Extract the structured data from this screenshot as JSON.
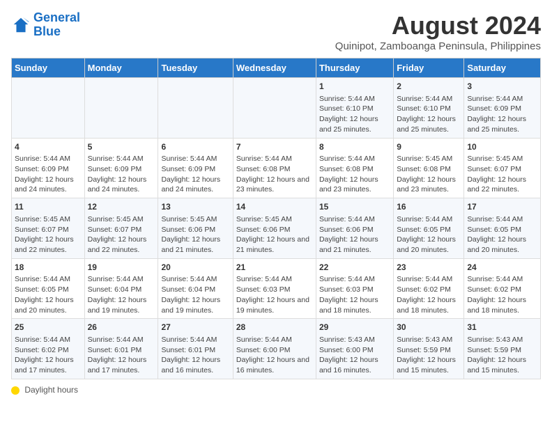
{
  "header": {
    "logo_general": "General",
    "logo_blue": "Blue",
    "main_title": "August 2024",
    "subtitle": "Quinipot, Zamboanga Peninsula, Philippines"
  },
  "columns": [
    "Sunday",
    "Monday",
    "Tuesday",
    "Wednesday",
    "Thursday",
    "Friday",
    "Saturday"
  ],
  "weeks": [
    [
      {
        "day": "",
        "info": ""
      },
      {
        "day": "",
        "info": ""
      },
      {
        "day": "",
        "info": ""
      },
      {
        "day": "",
        "info": ""
      },
      {
        "day": "1",
        "info": "Sunrise: 5:44 AM\nSunset: 6:10 PM\nDaylight: 12 hours and 25 minutes."
      },
      {
        "day": "2",
        "info": "Sunrise: 5:44 AM\nSunset: 6:10 PM\nDaylight: 12 hours and 25 minutes."
      },
      {
        "day": "3",
        "info": "Sunrise: 5:44 AM\nSunset: 6:09 PM\nDaylight: 12 hours and 25 minutes."
      }
    ],
    [
      {
        "day": "4",
        "info": "Sunrise: 5:44 AM\nSunset: 6:09 PM\nDaylight: 12 hours and 24 minutes."
      },
      {
        "day": "5",
        "info": "Sunrise: 5:44 AM\nSunset: 6:09 PM\nDaylight: 12 hours and 24 minutes."
      },
      {
        "day": "6",
        "info": "Sunrise: 5:44 AM\nSunset: 6:09 PM\nDaylight: 12 hours and 24 minutes."
      },
      {
        "day": "7",
        "info": "Sunrise: 5:44 AM\nSunset: 6:08 PM\nDaylight: 12 hours and 23 minutes."
      },
      {
        "day": "8",
        "info": "Sunrise: 5:44 AM\nSunset: 6:08 PM\nDaylight: 12 hours and 23 minutes."
      },
      {
        "day": "9",
        "info": "Sunrise: 5:45 AM\nSunset: 6:08 PM\nDaylight: 12 hours and 23 minutes."
      },
      {
        "day": "10",
        "info": "Sunrise: 5:45 AM\nSunset: 6:07 PM\nDaylight: 12 hours and 22 minutes."
      }
    ],
    [
      {
        "day": "11",
        "info": "Sunrise: 5:45 AM\nSunset: 6:07 PM\nDaylight: 12 hours and 22 minutes."
      },
      {
        "day": "12",
        "info": "Sunrise: 5:45 AM\nSunset: 6:07 PM\nDaylight: 12 hours and 22 minutes."
      },
      {
        "day": "13",
        "info": "Sunrise: 5:45 AM\nSunset: 6:06 PM\nDaylight: 12 hours and 21 minutes."
      },
      {
        "day": "14",
        "info": "Sunrise: 5:45 AM\nSunset: 6:06 PM\nDaylight: 12 hours and 21 minutes."
      },
      {
        "day": "15",
        "info": "Sunrise: 5:44 AM\nSunset: 6:06 PM\nDaylight: 12 hours and 21 minutes."
      },
      {
        "day": "16",
        "info": "Sunrise: 5:44 AM\nSunset: 6:05 PM\nDaylight: 12 hours and 20 minutes."
      },
      {
        "day": "17",
        "info": "Sunrise: 5:44 AM\nSunset: 6:05 PM\nDaylight: 12 hours and 20 minutes."
      }
    ],
    [
      {
        "day": "18",
        "info": "Sunrise: 5:44 AM\nSunset: 6:05 PM\nDaylight: 12 hours and 20 minutes."
      },
      {
        "day": "19",
        "info": "Sunrise: 5:44 AM\nSunset: 6:04 PM\nDaylight: 12 hours and 19 minutes."
      },
      {
        "day": "20",
        "info": "Sunrise: 5:44 AM\nSunset: 6:04 PM\nDaylight: 12 hours and 19 minutes."
      },
      {
        "day": "21",
        "info": "Sunrise: 5:44 AM\nSunset: 6:03 PM\nDaylight: 12 hours and 19 minutes."
      },
      {
        "day": "22",
        "info": "Sunrise: 5:44 AM\nSunset: 6:03 PM\nDaylight: 12 hours and 18 minutes."
      },
      {
        "day": "23",
        "info": "Sunrise: 5:44 AM\nSunset: 6:02 PM\nDaylight: 12 hours and 18 minutes."
      },
      {
        "day": "24",
        "info": "Sunrise: 5:44 AM\nSunset: 6:02 PM\nDaylight: 12 hours and 18 minutes."
      }
    ],
    [
      {
        "day": "25",
        "info": "Sunrise: 5:44 AM\nSunset: 6:02 PM\nDaylight: 12 hours and 17 minutes."
      },
      {
        "day": "26",
        "info": "Sunrise: 5:44 AM\nSunset: 6:01 PM\nDaylight: 12 hours and 17 minutes."
      },
      {
        "day": "27",
        "info": "Sunrise: 5:44 AM\nSunset: 6:01 PM\nDaylight: 12 hours and 16 minutes."
      },
      {
        "day": "28",
        "info": "Sunrise: 5:44 AM\nSunset: 6:00 PM\nDaylight: 12 hours and 16 minutes."
      },
      {
        "day": "29",
        "info": "Sunrise: 5:43 AM\nSunset: 6:00 PM\nDaylight: 12 hours and 16 minutes."
      },
      {
        "day": "30",
        "info": "Sunrise: 5:43 AM\nSunset: 5:59 PM\nDaylight: 12 hours and 15 minutes."
      },
      {
        "day": "31",
        "info": "Sunrise: 5:43 AM\nSunset: 5:59 PM\nDaylight: 12 hours and 15 minutes."
      }
    ]
  ],
  "footer": {
    "daylight_label": "Daylight hours"
  }
}
